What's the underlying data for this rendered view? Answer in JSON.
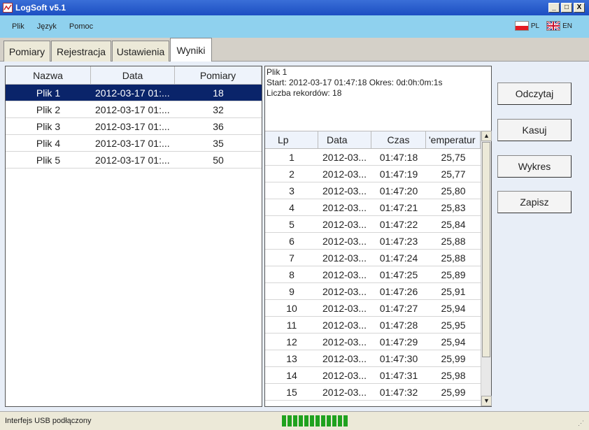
{
  "window": {
    "title": "LogSoft v5.1",
    "buttons": [
      "_",
      "□",
      "X"
    ]
  },
  "menu": {
    "items": [
      "Plik",
      "Język",
      "Pomoc"
    ]
  },
  "languages": [
    {
      "code": "PL",
      "icon": "flag-pl-icon"
    },
    {
      "code": "EN",
      "icon": "flag-uk-icon"
    }
  ],
  "tabs": [
    {
      "label": "Pomiary",
      "active": false
    },
    {
      "label": "Rejestracja",
      "active": false
    },
    {
      "label": "Ustawienia",
      "active": false
    },
    {
      "label": "Wyniki",
      "active": true
    }
  ],
  "files": {
    "columns": [
      "Nazwa",
      "Data",
      "Pomiary"
    ],
    "rows": [
      {
        "name": "Plik 1",
        "date": "2012-03-17 01:...",
        "count": "18",
        "selected": true
      },
      {
        "name": "Plik 2",
        "date": "2012-03-17 01:...",
        "count": "32",
        "selected": false
      },
      {
        "name": "Plik 3",
        "date": "2012-03-17 01:...",
        "count": "36",
        "selected": false
      },
      {
        "name": "Plik 4",
        "date": "2012-03-17 01:...",
        "count": "35",
        "selected": false
      },
      {
        "name": "Plik 5",
        "date": "2012-03-17 01:...",
        "count": "50",
        "selected": false
      }
    ]
  },
  "info": {
    "line1": "Plik 1",
    "line2": "Start: 2012-03-17 01:47:18  Okres: 0d:0h:0m:1s",
    "line3": "Liczba rekordów: 18"
  },
  "records": {
    "columns": [
      "Lp",
      "Data",
      "Czas",
      "'emperatur"
    ],
    "rows": [
      {
        "lp": "1",
        "date": "2012-03...",
        "time": "01:47:18",
        "temp": "25,75"
      },
      {
        "lp": "2",
        "date": "2012-03...",
        "time": "01:47:19",
        "temp": "25,77"
      },
      {
        "lp": "3",
        "date": "2012-03...",
        "time": "01:47:20",
        "temp": "25,80"
      },
      {
        "lp": "4",
        "date": "2012-03...",
        "time": "01:47:21",
        "temp": "25,83"
      },
      {
        "lp": "5",
        "date": "2012-03...",
        "time": "01:47:22",
        "temp": "25,84"
      },
      {
        "lp": "6",
        "date": "2012-03...",
        "time": "01:47:23",
        "temp": "25,88"
      },
      {
        "lp": "7",
        "date": "2012-03...",
        "time": "01:47:24",
        "temp": "25,88"
      },
      {
        "lp": "8",
        "date": "2012-03...",
        "time": "01:47:25",
        "temp": "25,89"
      },
      {
        "lp": "9",
        "date": "2012-03...",
        "time": "01:47:26",
        "temp": "25,91"
      },
      {
        "lp": "10",
        "date": "2012-03...",
        "time": "01:47:27",
        "temp": "25,94"
      },
      {
        "lp": "11",
        "date": "2012-03...",
        "time": "01:47:28",
        "temp": "25,95"
      },
      {
        "lp": "12",
        "date": "2012-03...",
        "time": "01:47:29",
        "temp": "25,94"
      },
      {
        "lp": "13",
        "date": "2012-03...",
        "time": "01:47:30",
        "temp": "25,99"
      },
      {
        "lp": "14",
        "date": "2012-03...",
        "time": "01:47:31",
        "temp": "25,98"
      },
      {
        "lp": "15",
        "date": "2012-03...",
        "time": "01:47:32",
        "temp": "25,99"
      }
    ]
  },
  "actions": {
    "read": "Odczytaj",
    "delete": "Kasuj",
    "chart": "Wykres",
    "save": "Zapisz"
  },
  "status": {
    "text": "Interfejs USB podłączony",
    "progress_segments": 12,
    "accent": "#1fa21f"
  }
}
